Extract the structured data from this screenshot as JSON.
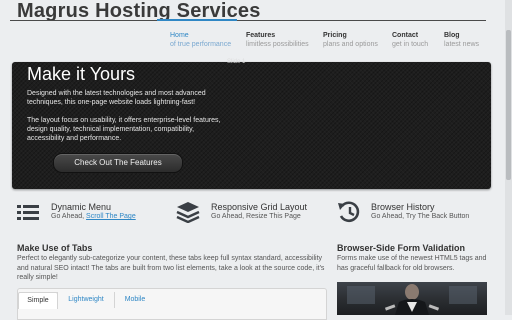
{
  "header": {
    "site_title": "Magrus Hosting Services",
    "accent_color": "#2f87c5"
  },
  "nav": [
    {
      "label": "Home",
      "sub": "of true performance",
      "active": true
    },
    {
      "label": "Features",
      "sub": "limitless possibilities",
      "active": false
    },
    {
      "label": "Pricing",
      "sub": "plans and options",
      "active": false
    },
    {
      "label": "Contact",
      "sub": "get in touch",
      "active": false
    },
    {
      "label": "Blog",
      "sub": "latest news",
      "active": false
    }
  ],
  "hero": {
    "slide_tag": "Slide 1",
    "title": "Make it Yours",
    "para1": "Designed with the latest technologies and most advanced techniques, this one-page website loads lightning-fast!",
    "para2": "The layout focus on usability, it offers enterprise-level features, design quality, technical implementation, compatibility, accessibility and performance.",
    "button_label": "Check Out The Features"
  },
  "features": [
    {
      "icon": "menu-lines-icon",
      "title": "Dynamic Menu",
      "sub_prefix": "Go Ahead, ",
      "sub_link": "Scroll The Page",
      "sub_suffix": ""
    },
    {
      "icon": "stacked-layers-icon",
      "title": "Responsive Grid Layout",
      "sub_prefix": "Go Ahead, Resize This Page",
      "sub_link": "",
      "sub_suffix": ""
    },
    {
      "icon": "history-clock-icon",
      "title": "Browser History",
      "sub_prefix": "Go Ahead, Try The Back Button",
      "sub_link": "",
      "sub_suffix": ""
    }
  ],
  "tabs_section": {
    "title": "Make Use of Tabs",
    "text": "Perfect to elegantly sub-categorize your content, these tabs keep full syntax standard, accessibility and natural SEO intact! The tabs are built from two list elements, take a look at the source code, it's really simple!",
    "tabs": [
      "Simple",
      "Lightweight",
      "Mobile"
    ]
  },
  "validation_section": {
    "title": "Browser-Side Form Validation",
    "text": "Forms make use of the newest HTML5 tags and has graceful fallback for old browsers."
  }
}
